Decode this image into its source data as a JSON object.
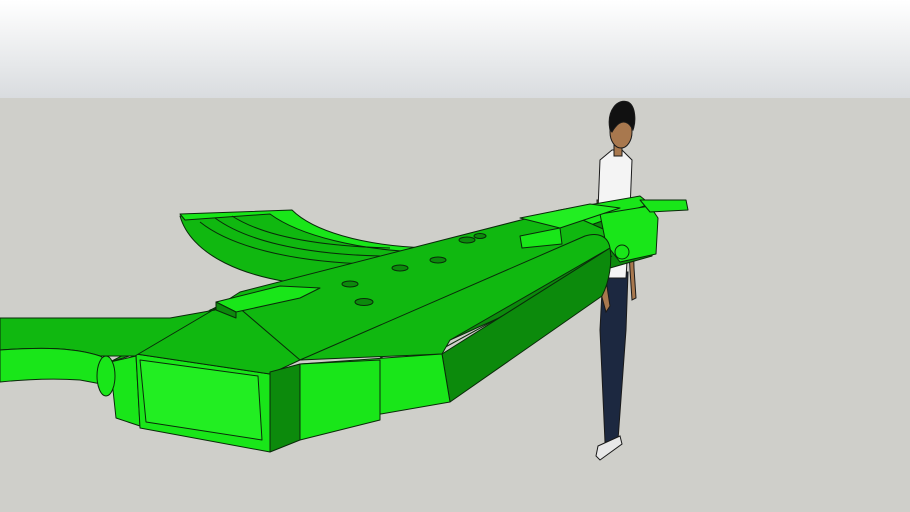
{
  "scene": {
    "description_tag": "3d-model-viewport",
    "colors": {
      "sky_top": "#ffffff",
      "sky_bottom": "#d9dcdf",
      "ground": "#cfcfca",
      "model_light": "#19e619",
      "model_mid": "#10b810",
      "model_dark": "#0c8a0c",
      "model_outline": "#0a2a0a",
      "figure_shirt": "#f4f4f4",
      "figure_pants": "#1c2840",
      "figure_skin": "#a8784e",
      "figure_hair": "#111111"
    }
  }
}
